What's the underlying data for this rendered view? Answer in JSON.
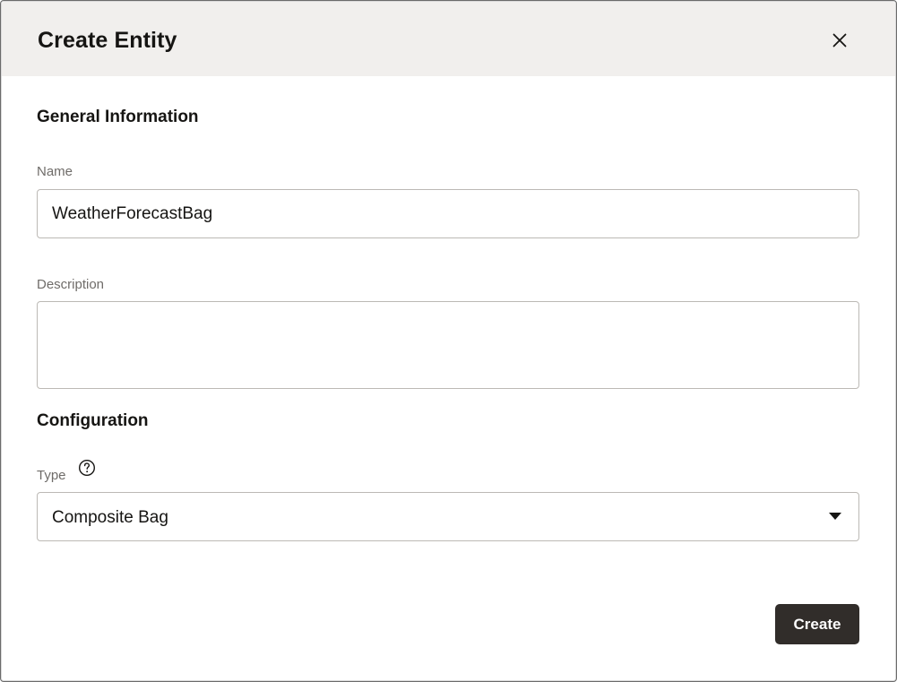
{
  "dialog": {
    "title": "Create Entity",
    "close_icon": "close-icon"
  },
  "general": {
    "heading": "General Information",
    "name_label": "Name",
    "name_value": "WeatherForecastBag",
    "description_label": "Description",
    "description_value": ""
  },
  "configuration": {
    "heading": "Configuration",
    "type_label": "Type",
    "type_help_icon": "question-circle-icon",
    "type_value": "Composite Bag",
    "type_caret_icon": "caret-down-icon"
  },
  "footer": {
    "create_label": "Create"
  },
  "colors": {
    "header_bg": "#f1efed",
    "primary_button": "#312d2a",
    "label_text": "#6f6c69",
    "border": "#bcb9b5"
  }
}
